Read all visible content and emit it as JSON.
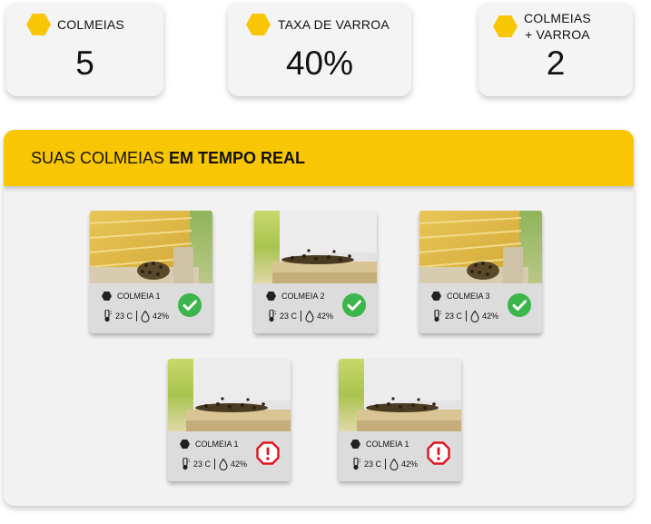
{
  "stats": [
    {
      "label": "COLMEIAS",
      "value": "5"
    },
    {
      "label": "TAXA DE VARROA",
      "value": "40%"
    },
    {
      "label_line1": "COLMEIAS",
      "label_line2": "+ VARROA",
      "value": "2"
    }
  ],
  "panel": {
    "title_light": "SUAS COLMEIAS",
    "title_bold": "EM TEMPO REAL"
  },
  "hives": [
    {
      "name": "COLMEIA 1",
      "temperature": "23 C",
      "humidity": "42%",
      "status": "ok",
      "photo": "hive-box-photo"
    },
    {
      "name": "COLMEIA 2",
      "temperature": "23 C",
      "humidity": "42%",
      "status": "ok",
      "photo": "hive-entrance-photo"
    },
    {
      "name": "COLMEIA 3",
      "temperature": "23 C",
      "humidity": "42%",
      "status": "ok",
      "photo": "hive-box-photo"
    },
    {
      "name": "COLMEIA 1",
      "temperature": "23 C",
      "humidity": "42%",
      "status": "alert",
      "photo": "hive-entrance-photo"
    },
    {
      "name": "COLMEIA 1",
      "temperature": "23 C",
      "humidity": "42%",
      "status": "alert",
      "photo": "hive-entrance-photo"
    }
  ],
  "colors": {
    "accent_yellow": "#f9c605",
    "ok_green": "#3cb54a",
    "alert_red": "#e0141c",
    "panel_bg": "#f2f2f2"
  }
}
